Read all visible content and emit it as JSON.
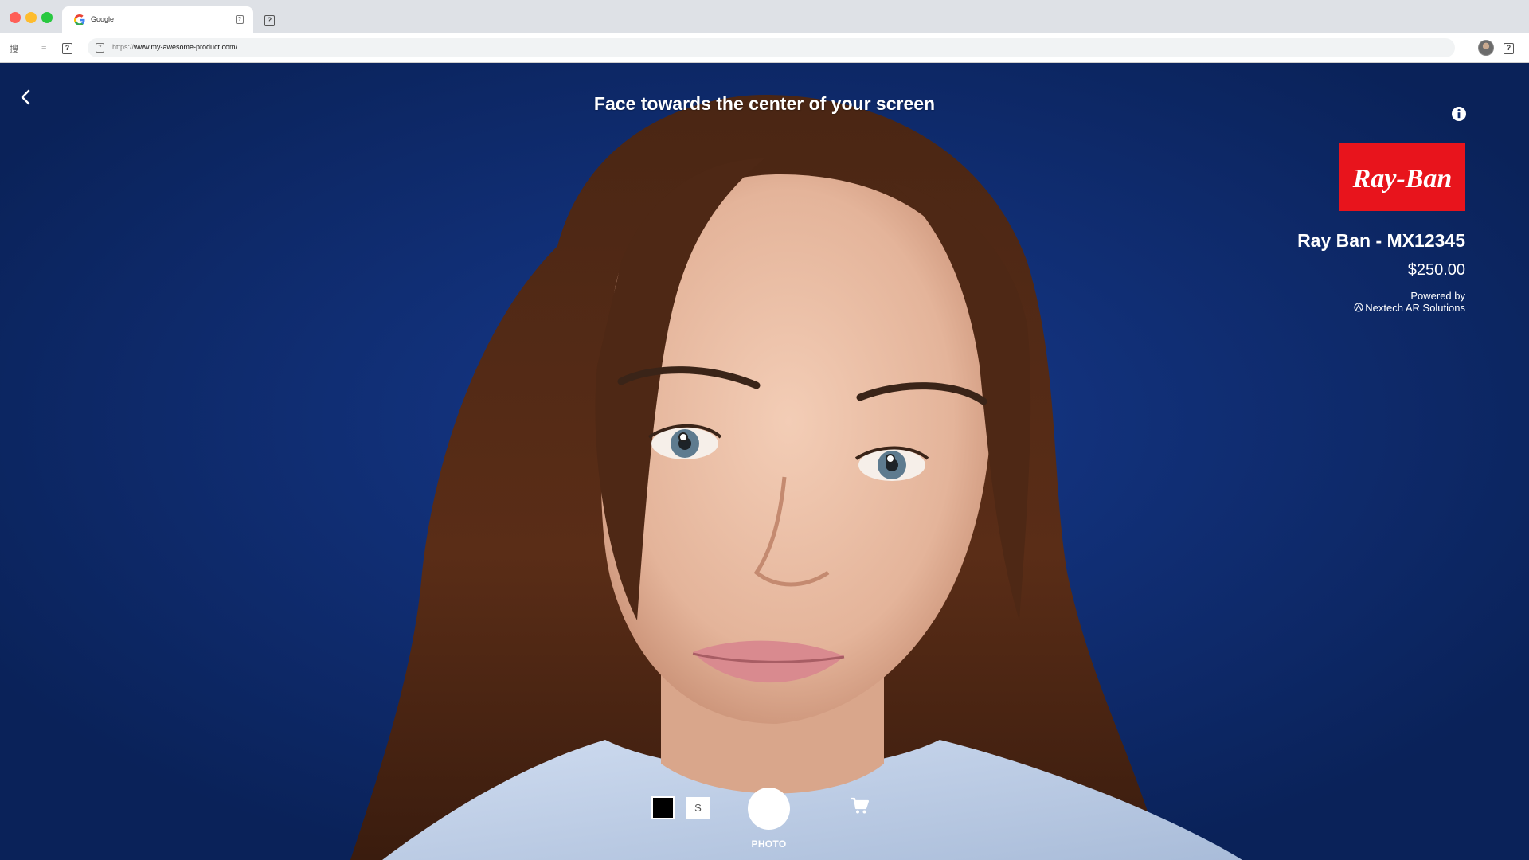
{
  "browser": {
    "tab_title": "Google",
    "tab_close_glyph": "?",
    "new_tab_glyph": "?",
    "toolbar_glyph_1": "搜",
    "toolbar_glyph_2": "≡",
    "toolbar_box_glyph": "?",
    "url_icon_glyph": "?",
    "url_scheme": "https://",
    "url_host": "www.my-awesome-product.com/",
    "menu_glyph": "?"
  },
  "ar": {
    "instruction": "Face towards the center of your screen",
    "back_icon": "chevron-left-icon",
    "info_icon": "info-icon"
  },
  "product": {
    "brand_logo_text": "Ray-Ban",
    "name": "Ray Ban - MX12345",
    "price": "$250.00",
    "powered_by_label": "Powered by",
    "powered_by_company": "Nextech AR Solutions"
  },
  "controls": {
    "color_swatch": "#000000",
    "size_label": "S",
    "shutter_label": "PHOTO",
    "cart_icon": "cart-icon"
  },
  "colors": {
    "brand_red": "#e8141c",
    "background_blue": "#123482"
  }
}
